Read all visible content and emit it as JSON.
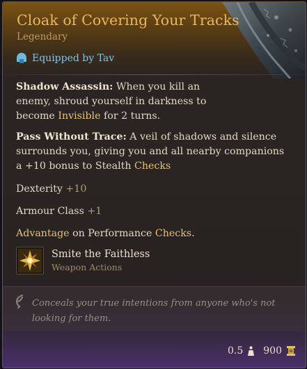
{
  "item": {
    "title": "Cloak of Covering Your Tracks",
    "rarity": "Legendary",
    "equipped": "Equipped by Tav"
  },
  "colors": {
    "title": "#e9b65c",
    "keyword": "#e8c07a",
    "equipped": "#7ec6ea",
    "bonus": "#b89a74"
  },
  "passives": [
    {
      "name": "Shadow Assassin:",
      "text_before": "When you kill an enemy, shroud yourself in darkness to become",
      "keyword": "Invisible",
      "text_after": "for 2 turns."
    },
    {
      "name": "Pass Without Trace:",
      "text_before": "A veil of shadows and silence surrounds you, giving you and all nearby companions a +10 bonus to Stealth",
      "keyword": "Checks"
    }
  ],
  "stats": [
    {
      "label": "Dexterity",
      "value": "+10"
    },
    {
      "label": "Armour Class",
      "value": "+1"
    }
  ],
  "advantage": {
    "keyword1": "Advantage",
    "middle": "on Performance",
    "keyword2": "Checks",
    "end": "."
  },
  "action": {
    "icon": "smite-faithless-icon",
    "name": "Smite the Faithless",
    "type": "Weapon Actions"
  },
  "flavor": {
    "icon": "quill-icon",
    "text": "Conceals your true intentions from anyone who's not looking for them."
  },
  "footer": {
    "weight": "0.5",
    "weight_icon": "weight-icon",
    "value": "900",
    "value_icon": "gold-icon"
  }
}
